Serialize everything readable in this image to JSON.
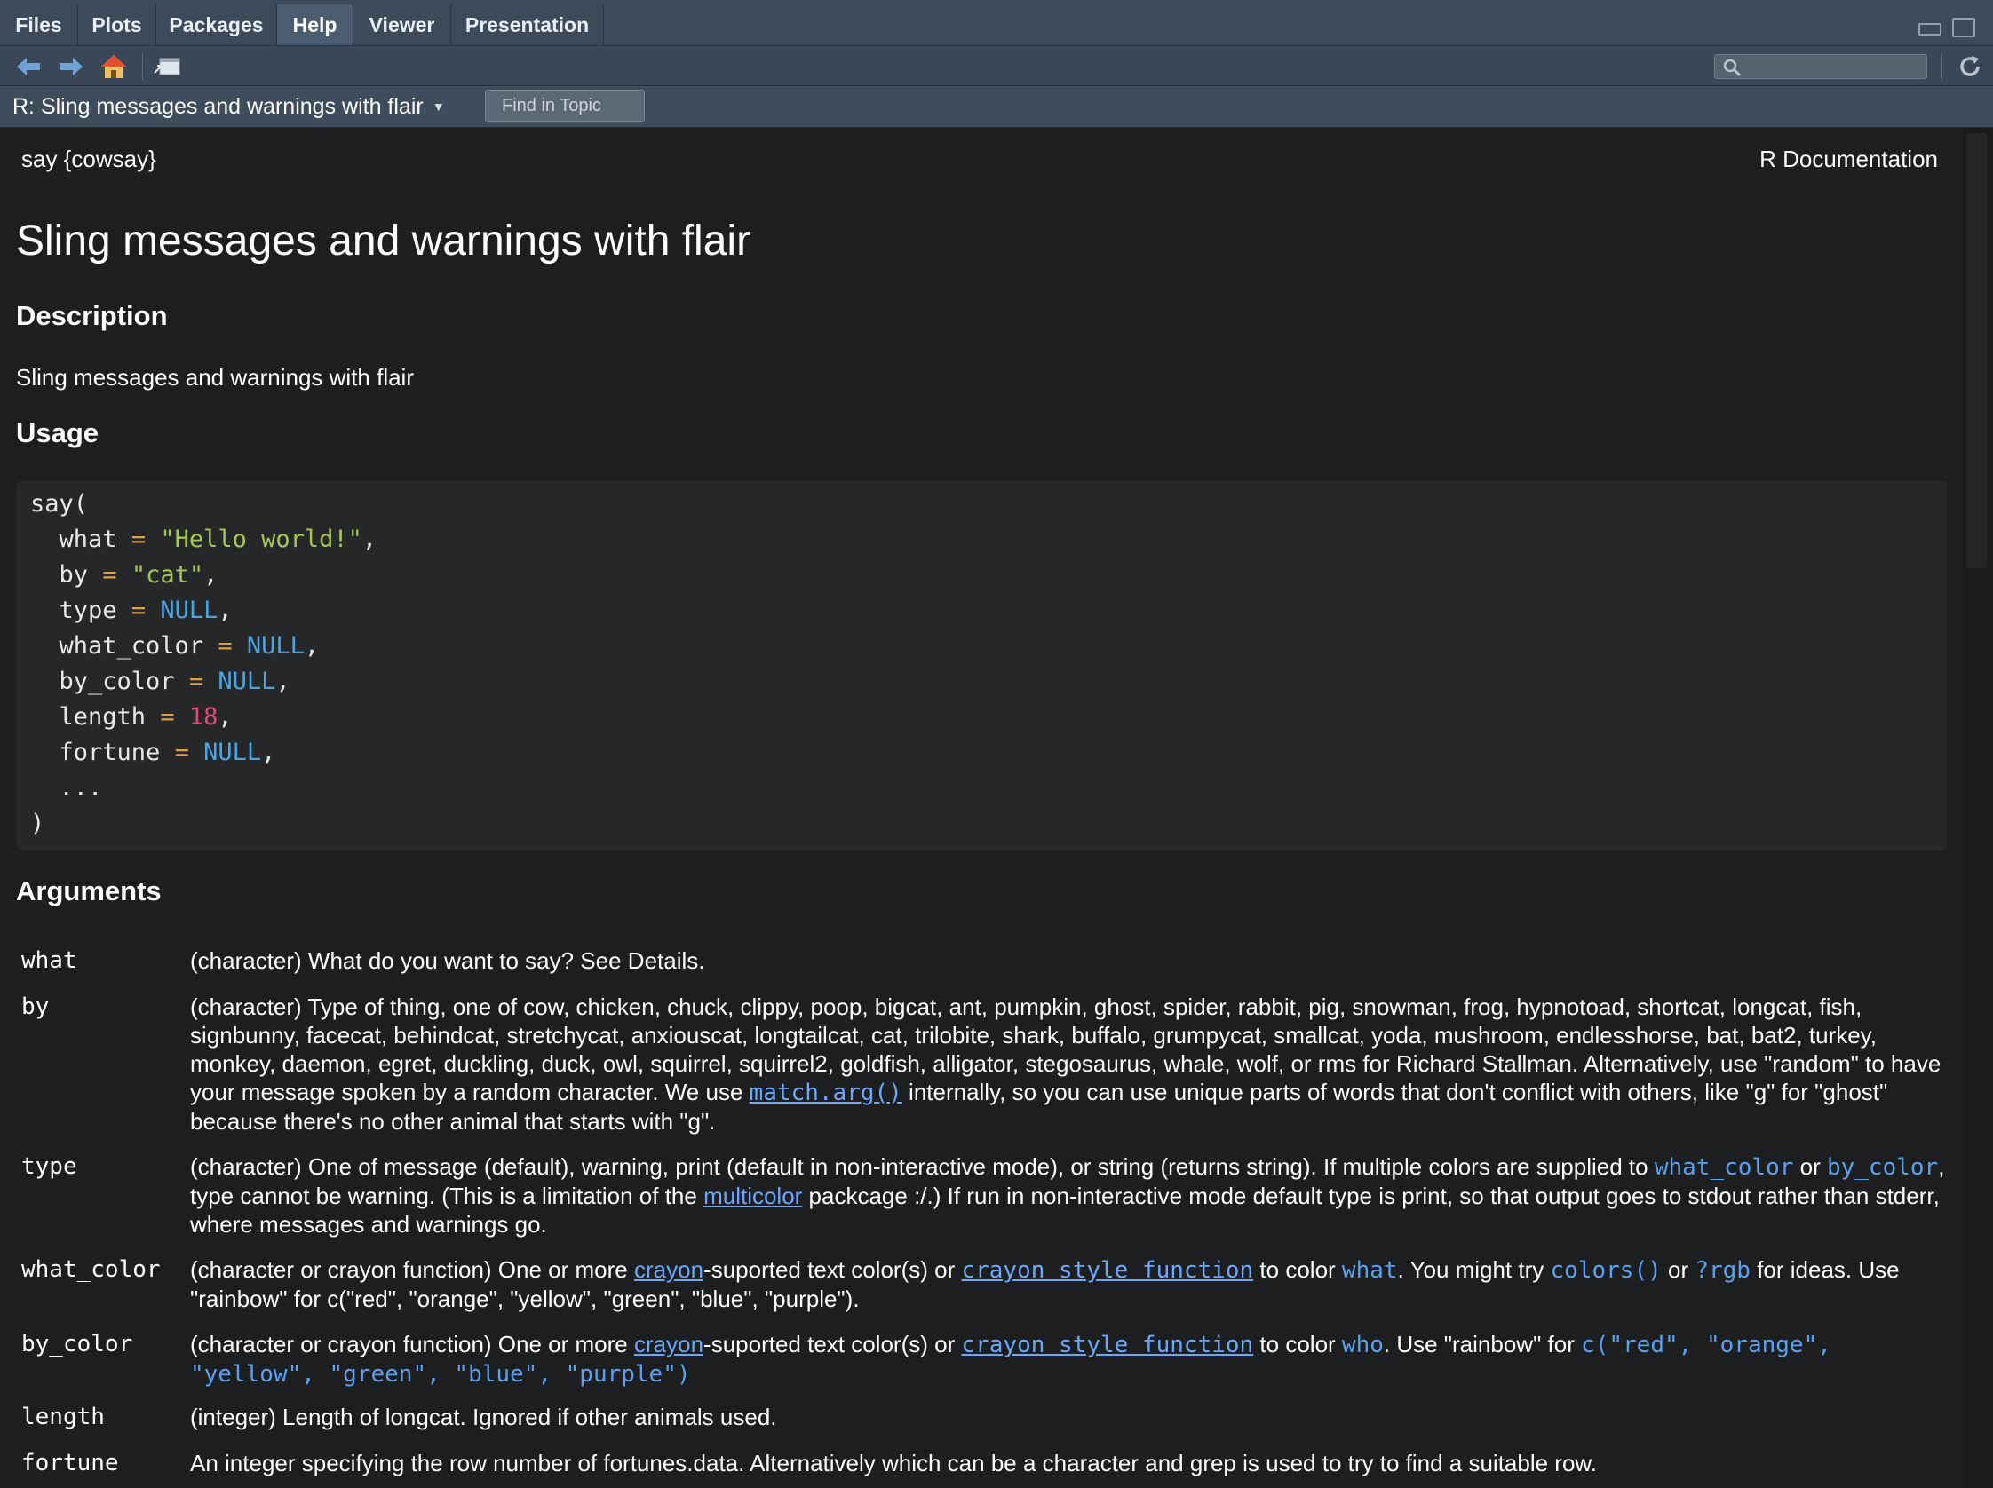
{
  "tabs": [
    {
      "label": "Files"
    },
    {
      "label": "Plots"
    },
    {
      "label": "Packages"
    },
    {
      "label": "Help"
    },
    {
      "label": "Viewer"
    },
    {
      "label": "Presentation"
    }
  ],
  "active_tab": "Help",
  "topic": {
    "title": "R: Sling messages and warnings with flair",
    "find_placeholder": "Find in Topic"
  },
  "doc": {
    "package_ref": "say {cowsay}",
    "r_documentation": "R Documentation",
    "title": "Sling messages and warnings with flair",
    "description_heading": "Description",
    "description_text": "Sling messages and warnings with flair",
    "usage_heading": "Usage",
    "arguments_heading": "Arguments"
  },
  "usage": {
    "fn_open": "say(",
    "args": [
      {
        "name": "what",
        "value": "\"Hello world!\"",
        "kind": "str"
      },
      {
        "name": "by",
        "value": "\"cat\"",
        "kind": "str"
      },
      {
        "name": "type",
        "value": "NULL",
        "kind": "nul"
      },
      {
        "name": "what_color",
        "value": "NULL",
        "kind": "nul"
      },
      {
        "name": "by_color",
        "value": "NULL",
        "kind": "nul"
      },
      {
        "name": "length",
        "value": "18",
        "kind": "num"
      },
      {
        "name": "fortune",
        "value": "NULL",
        "kind": "nul"
      }
    ],
    "dots": "...",
    "fn_close": ")"
  },
  "arguments": {
    "what": {
      "name": "what",
      "desc": "(character) What do you want to say? See Details."
    },
    "by": {
      "name": "by",
      "desc_1": "(character) Type of thing, one of cow, chicken, chuck, clippy, poop, bigcat, ant, pumpkin, ghost, spider, rabbit, pig, snowman, frog, hypnotoad, shortcat, longcat, fish, signbunny, facecat, behindcat, stretchycat, anxiouscat, longtailcat, cat, trilobite, shark, buffalo, grumpycat, smallcat, yoda, mushroom, endlesshorse, bat, bat2, turkey, monkey, daemon, egret, duckling, duck, owl, squirrel, squirrel2, goldfish, alligator, stegosaurus, whale, wolf, or rms for Richard Stallman. Alternatively, use \"random\" to have your message spoken by a random character. We use ",
      "link": "match.arg()",
      "desc_2": " internally, so you can use unique parts of words that don't conflict with others, like \"g\" for \"ghost\" because there's no other animal that starts with \"g\"."
    },
    "type": {
      "name": "type",
      "desc_1": "(character) One of message (default), warning, print (default in non-interactive mode), or string (returns string). If multiple colors are supplied to ",
      "code_1": "what_color",
      "desc_2": " or ",
      "code_2": "by_color",
      "desc_3": ", type cannot be warning. (This is a limitation of the ",
      "link": "multicolor",
      "desc_4": " packcage :/.) If run in non-interactive mode default type is print, so that output goes to stdout rather than stderr, where messages and warnings go."
    },
    "what_color": {
      "name": "what_color",
      "desc_1": "(character or crayon function) One or more ",
      "link_1": "crayon",
      "desc_2": "-suported text color(s) or ",
      "link_2": "crayon style function",
      "desc_3": " to color ",
      "code_1": "what",
      "desc_4": ". You might try ",
      "code_2": "colors()",
      "desc_5": " or ",
      "code_3": "?rgb",
      "desc_6": " for ideas. Use \"rainbow\" for c(\"red\", \"orange\", \"yellow\", \"green\", \"blue\", \"purple\")."
    },
    "by_color": {
      "name": "by_color",
      "desc_1": "(character or crayon function) One or more ",
      "link_1": "crayon",
      "desc_2": "-suported text color(s) or ",
      "link_2": "crayon style function",
      "desc_3": " to color ",
      "code_1": "who",
      "desc_4": ". Use \"rainbow\" for ",
      "code_2": "c(\"red\", \"orange\", \"yellow\", \"green\", \"blue\", \"purple\")"
    },
    "length": {
      "name": "length",
      "desc": "(integer) Length of longcat. Ignored if other animals used."
    },
    "fortune": {
      "name": "fortune",
      "desc": "An integer specifying the row number of fortunes.data. Alternatively which can be a character and grep is used to try to find a suitable row."
    }
  },
  "icons": [
    "back-arrow-icon",
    "forward-arrow-icon",
    "home-icon",
    "show-in-window-icon",
    "search-icon",
    "refresh-icon",
    "minimize-icon",
    "maximize-icon"
  ],
  "colors": {
    "tab_bar": "#3c4a5a",
    "background": "#1d1e1f",
    "code_bg": "#262728",
    "string": "#a6c851",
    "null": "#47a6e6",
    "number": "#e04a7a",
    "link": "#6aa8ff"
  }
}
